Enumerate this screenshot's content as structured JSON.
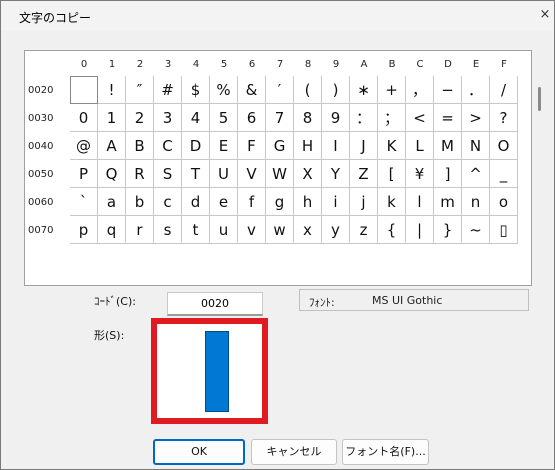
{
  "window": {
    "title": "文字のコピー",
    "close_glyph": "×"
  },
  "columns": [
    "0",
    "1",
    "2",
    "3",
    "4",
    "5",
    "6",
    "7",
    "8",
    "9",
    "A",
    "B",
    "C",
    "D",
    "E",
    "F"
  ],
  "rows": [
    {
      "code": "0020",
      "chars": [
        "",
        " !",
        "″",
        "#",
        "$",
        "%",
        "&",
        "′",
        "(",
        ")",
        "∗",
        "+",
        "，",
        "−",
        "．",
        "/"
      ]
    },
    {
      "code": "0030",
      "chars": [
        "0",
        "1",
        "2",
        "3",
        "4",
        "5",
        "6",
        "7",
        "8",
        "9",
        "：",
        "；",
        "<",
        "=",
        ">",
        "?"
      ]
    },
    {
      "code": "0040",
      "chars": [
        "@",
        "A",
        "B",
        "C",
        "D",
        "E",
        "F",
        "G",
        "H",
        "I",
        "J",
        "K",
        "L",
        "M",
        "N",
        "O"
      ]
    },
    {
      "code": "0050",
      "chars": [
        "P",
        "Q",
        "R",
        "S",
        "T",
        "U",
        "V",
        "W",
        "X",
        "Y",
        "Z",
        "[",
        "¥",
        "]",
        "^",
        "_"
      ]
    },
    {
      "code": "0060",
      "chars": [
        "`",
        "a",
        "b",
        "c",
        "d",
        "e",
        "f",
        "g",
        "h",
        "i",
        "j",
        "k",
        "l",
        "m",
        "n",
        "o"
      ]
    },
    {
      "code": "0070",
      "chars": [
        "p",
        "q",
        "r",
        "s",
        "t",
        "u",
        "v",
        "w",
        "x",
        "y",
        "z",
        "{",
        "|",
        "}",
        "~",
        "▯"
      ]
    }
  ],
  "code_field": {
    "label": "ｺｰﾄﾞ(C):",
    "value": "0020"
  },
  "font_field": {
    "label": "ﾌｫﾝﾄ:",
    "value": "MS UI Gothic"
  },
  "shape_label": "形(S):",
  "buttons": {
    "ok": "OK",
    "cancel": "キャンセル",
    "font_name": "フォント名(F)..."
  },
  "colors": {
    "highlight_border": "#e11b22",
    "glyph_fill": "#0078d4",
    "default_button": "#0067c0"
  }
}
